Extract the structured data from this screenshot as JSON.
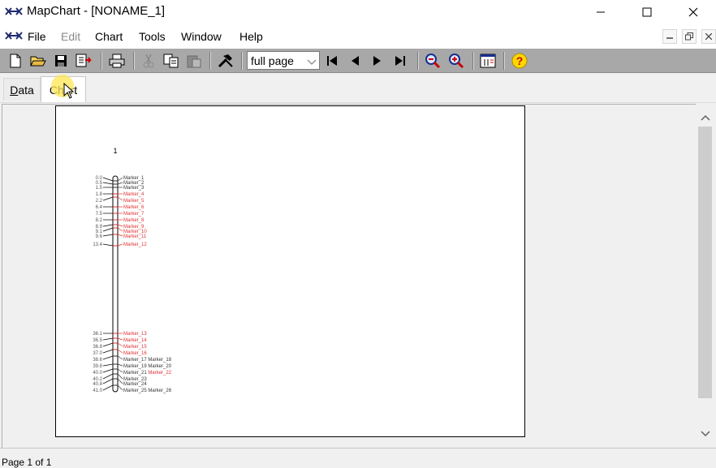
{
  "window": {
    "title": "MapChart - [NONAME_1]"
  },
  "menu": {
    "items": [
      "File",
      "Edit",
      "Chart",
      "Tools",
      "Window",
      "Help"
    ]
  },
  "toolbar": {
    "zoom_value": "full page",
    "icons": [
      "new-file-icon",
      "open-folder-icon",
      "save-icon",
      "export-icon",
      "print-icon",
      "cut-icon",
      "copy-icon",
      "paste-icon",
      "tools-icon",
      "first-page-icon",
      "prev-page-icon",
      "next-page-icon",
      "last-page-icon",
      "zoom-out-icon",
      "zoom-in-icon",
      "chart-properties-icon",
      "help-icon"
    ]
  },
  "tabs": {
    "data": "Data",
    "chart": "Chart"
  },
  "chart": {
    "group_label": "1",
    "markers": [
      {
        "pos": "0.0",
        "name": "Marker_1",
        "color": "#333333"
      },
      {
        "pos": "0.5",
        "name": "Marker_2",
        "color": "#333333"
      },
      {
        "pos": "1.5",
        "name": "Marker_3",
        "color": "#333333"
      },
      {
        "pos": "1.8",
        "name": "Marker_4",
        "color": "#e03030"
      },
      {
        "pos": "2.2",
        "name": "Marker_5",
        "color": "#e03030"
      },
      {
        "pos": "6.4",
        "name": "Marker_6",
        "color": "#e03030"
      },
      {
        "pos": "7.5",
        "name": "Marker_7",
        "color": "#e03030"
      },
      {
        "pos": "8.2",
        "name": "Marker_8",
        "color": "#e03030"
      },
      {
        "pos": "8.9",
        "name": "Marker_9",
        "color": "#e03030"
      },
      {
        "pos": "9.1",
        "name": "Marker_10",
        "color": "#e03030"
      },
      {
        "pos": "9.6",
        "name": "Marker_11",
        "color": "#e03030"
      },
      {
        "pos": "13.4",
        "name": "Marker_12",
        "color": "#e03030"
      },
      {
        "pos": "36.1",
        "name": "Marker_13",
        "color": "#e03030"
      },
      {
        "pos": "36.5",
        "name": "Marker_14",
        "color": "#e03030"
      },
      {
        "pos": "36.8",
        "name": "Marker_15",
        "color": "#e03030"
      },
      {
        "pos": "37.0",
        "name": "Marker_16",
        "color": "#e03030"
      },
      {
        "pos": "38.6",
        "name": "Marker_17 Marker_18",
        "color": "#333333"
      },
      {
        "pos": "39.8",
        "name": "Marker_19 Marker_20",
        "color": "#333333"
      },
      {
        "pos": "40.0",
        "name": "Marker_21 Marker_22",
        "color": "#333333",
        "name_second_color": "#e03030"
      },
      {
        "pos": "40.2",
        "name": "Marker_23",
        "color": "#333333"
      },
      {
        "pos": "40.8",
        "name": "Marker_24",
        "color": "#333333"
      },
      {
        "pos": "41.0",
        "name": "Marker_25 Marker_26",
        "color": "#333333"
      }
    ]
  },
  "status": {
    "page": "Page 1 of 1"
  }
}
